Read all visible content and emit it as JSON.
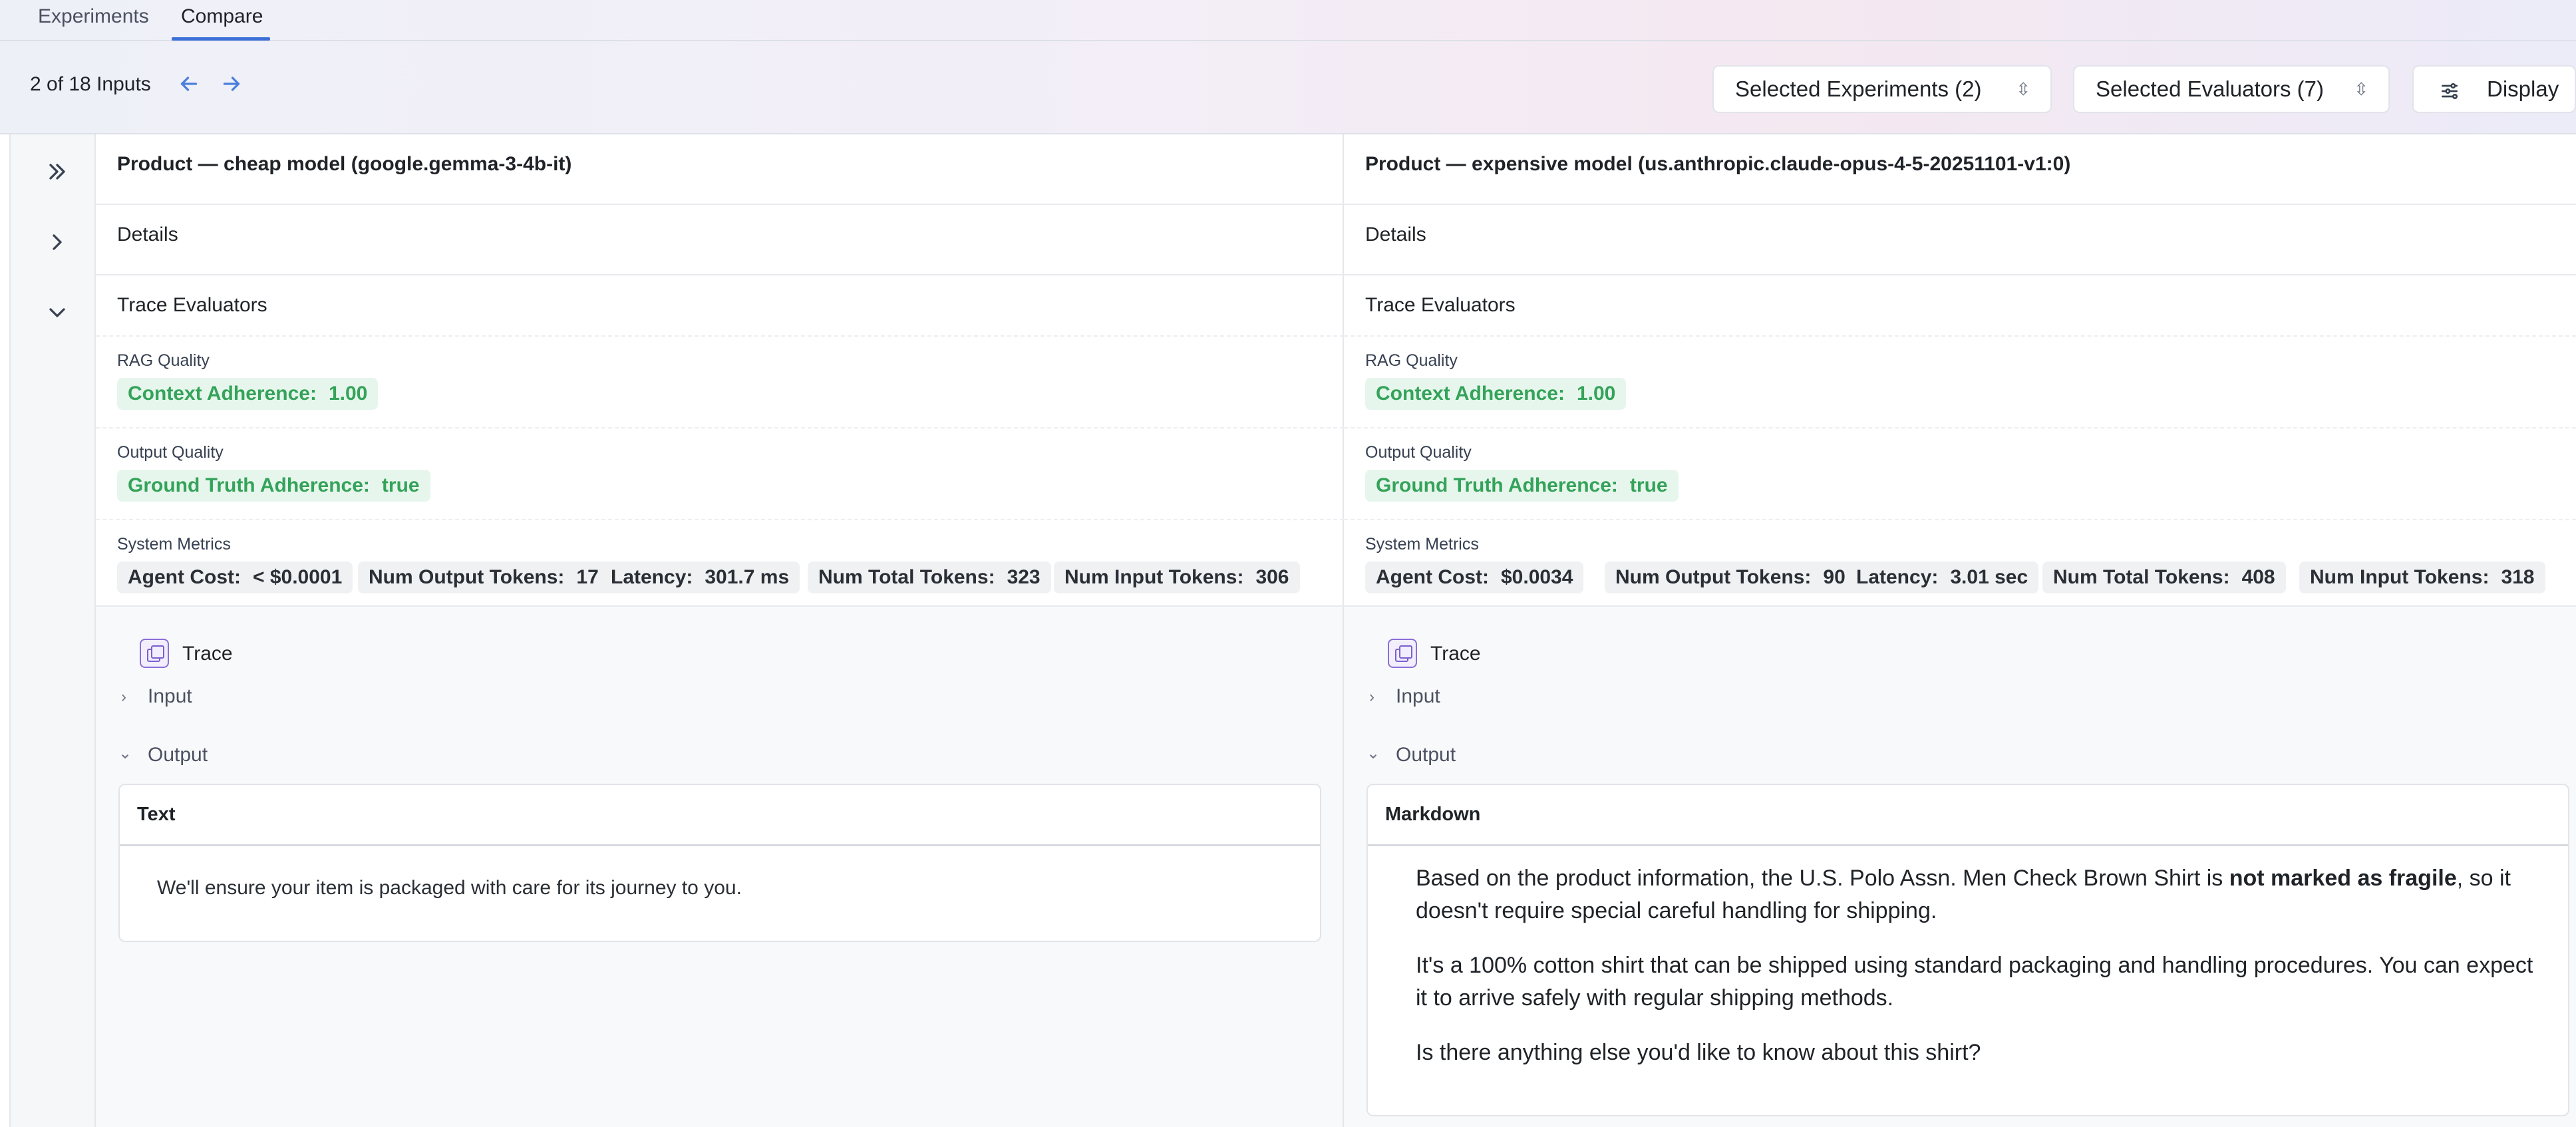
{
  "tabs": [
    {
      "label": "Experiments"
    },
    {
      "label": "Compare"
    }
  ],
  "toolbar": {
    "counter": "2 of 18 Inputs",
    "selected_experiments": "Selected Experiments (2)",
    "selected_evaluators": "Selected Evaluators (7)",
    "display": "Display"
  },
  "columns": [
    {
      "title": "Product — cheap model (google.gemma-3-4b-it)",
      "details": "Details",
      "trace_evaluators": "Trace Evaluators",
      "rag_quality": {
        "label": "RAG Quality",
        "chip_name": "Context Adherence:",
        "chip_value": "1.00"
      },
      "output_quality": {
        "label": "Output Quality",
        "chip_name": "Ground Truth Adherence:",
        "chip_value": "true"
      },
      "system_metrics": {
        "label": "System Metrics",
        "chips": [
          {
            "name": "Agent Cost:",
            "value": "< $0.0001"
          },
          {
            "name": "Num Output Tokens:",
            "value": "17"
          },
          {
            "name": "Latency:",
            "value": "301.7 ms"
          },
          {
            "name": "Num Total Tokens:",
            "value": "323"
          },
          {
            "name": "Num Input Tokens:",
            "value": "306"
          }
        ]
      },
      "trace": {
        "label": "Trace",
        "input": "Input",
        "output": "Output",
        "card_title": "Text",
        "text": "We'll ensure your item is packaged with care for its journey to you."
      }
    },
    {
      "title": "Product — expensive model (us.anthropic.claude-opus-4-5-20251101-v1:0)",
      "details": "Details",
      "trace_evaluators": "Trace Evaluators",
      "rag_quality": {
        "label": "RAG Quality",
        "chip_name": "Context Adherence:",
        "chip_value": "1.00"
      },
      "output_quality": {
        "label": "Output Quality",
        "chip_name": "Ground Truth Adherence:",
        "chip_value": "true"
      },
      "system_metrics": {
        "label": "System Metrics",
        "chips": [
          {
            "name": "Agent Cost:",
            "value": "$0.0034"
          },
          {
            "name": "Num Output Tokens:",
            "value": "90"
          },
          {
            "name": "Latency:",
            "value": "3.01 sec"
          },
          {
            "name": "Num Total Tokens:",
            "value": "408"
          },
          {
            "name": "Num Input Tokens:",
            "value": "318"
          }
        ]
      },
      "trace": {
        "label": "Trace",
        "input": "Input",
        "output": "Output",
        "card_title": "Markdown",
        "p1_before": "Based on the product information, the U.S. Polo Assn. Men Check Brown Shirt is ",
        "p1_bold": "not marked as fragile",
        "p1_after": ", so it doesn't require special careful handling for shipping.",
        "p2": "It's a 100% cotton shirt that can be shipped using standard packaging and handling procedures. You can expect it to arrive safely with regular shipping methods.",
        "p3": "Is there anything else you'd like to know about this shirt?"
      }
    }
  ],
  "icons": {
    "rail": [
      "double-chevron-right-icon",
      "chevron-right-icon",
      "chevron-down-icon"
    ],
    "nav": [
      "arrow-left-icon",
      "arrow-right-icon"
    ],
    "display": "sliders-icon",
    "trace": "trace-icon"
  },
  "colors": {
    "accent": "#3b6fd6",
    "green_chip_bg": "#e7f6ec",
    "green_chip_text": "#34a35a",
    "trace_icon": "#7b5fd0"
  }
}
